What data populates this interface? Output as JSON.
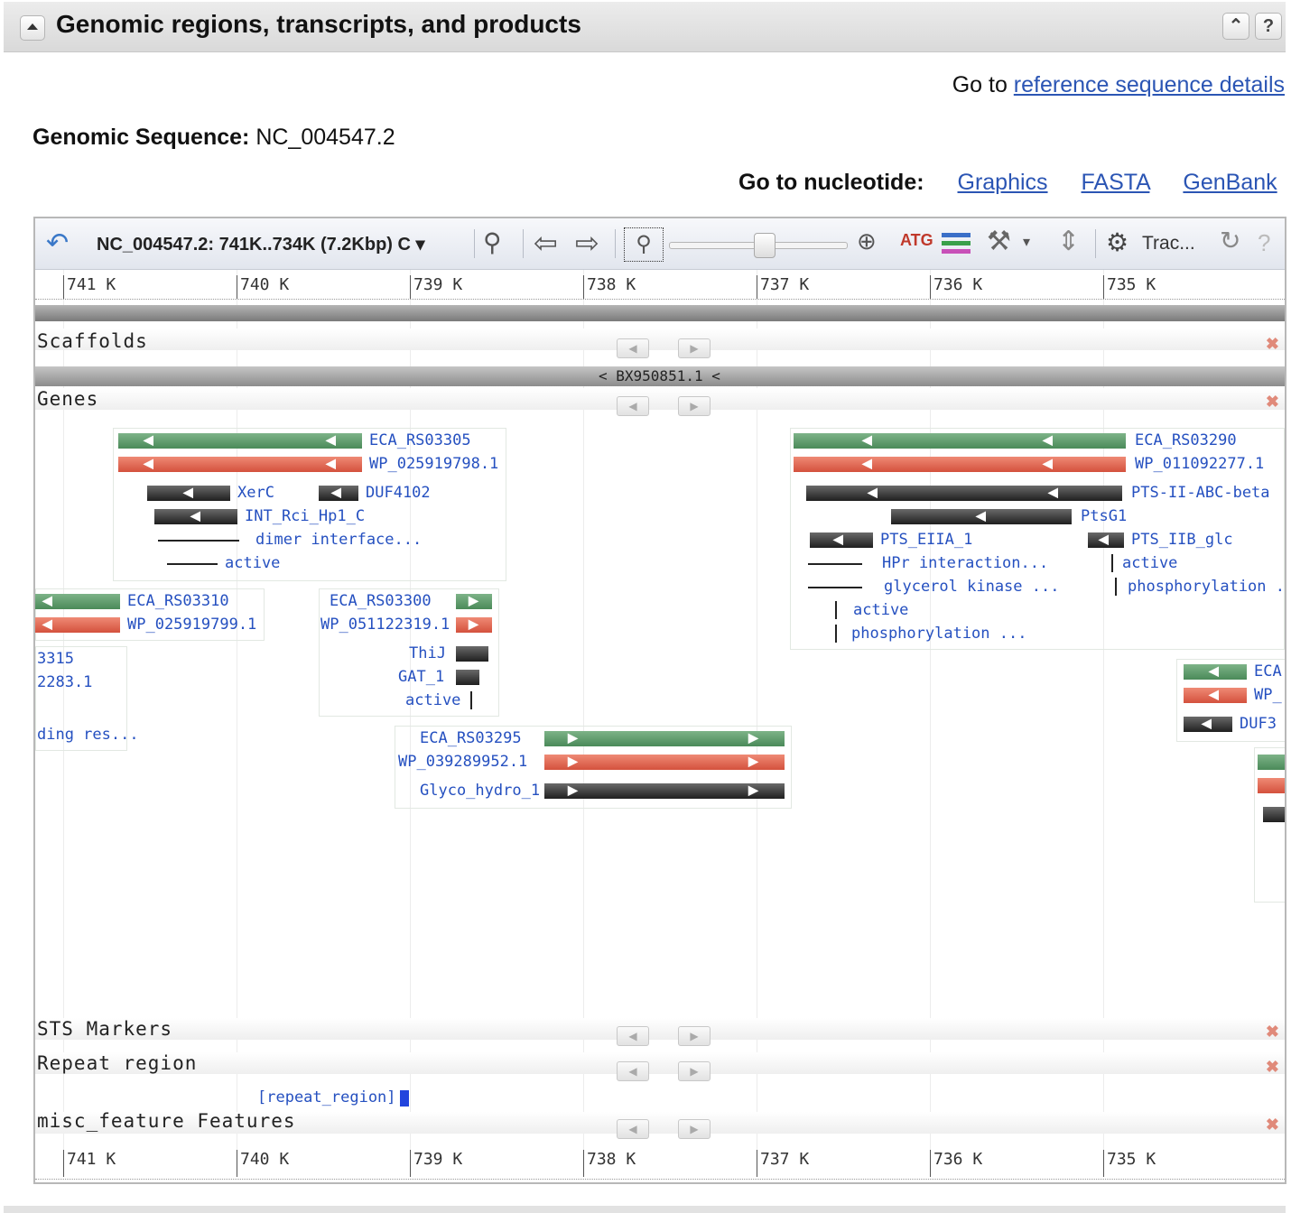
{
  "section": {
    "title": "Genomic regions, transcripts, and products"
  },
  "goto": {
    "prefix": "Go to ",
    "link": "reference sequence details"
  },
  "genomic": {
    "label": "Genomic Sequence:",
    "value": "NC_004547.2"
  },
  "nucleotide": {
    "label": "Go to nucleotide:",
    "links": [
      "Graphics",
      "FASTA",
      "GenBank"
    ]
  },
  "toolbar": {
    "region": "NC_004547.2: 741K..734K (7.2Kbp) C",
    "tracks": "Trac..."
  },
  "ruler": {
    "ticks": [
      "741 K",
      "740 K",
      "739 K",
      "738 K",
      "737 K",
      "736 K",
      "735 K"
    ]
  },
  "tracks": {
    "scaffolds": "Scaffolds",
    "scaffold_name": "BX950851.1",
    "genes": "Genes",
    "sts": "STS Markers",
    "repeat": "Repeat region",
    "repeat_feature": "[repeat_region]",
    "misc": "misc_feature Features"
  },
  "genes": {
    "g1": {
      "gene": "ECA_RS03305",
      "protein": "WP_025919798.1",
      "d1": "XerC",
      "d2": "DUF4102",
      "d3": "INT_Rci_Hp1_C",
      "d4": "dimer interface...",
      "d5": "active"
    },
    "g2": {
      "gene": "ECA_RS03290",
      "protein": "WP_011092277.1",
      "d1": "PTS-II-ABC-beta",
      "d2": "PtsG1",
      "d3": "PTS_EIIA_1",
      "d4": "PTS_IIB_glc",
      "d5": "HPr interaction...",
      "d6": "active",
      "d7": "glycerol kinase ...",
      "d8": "phosphorylation ...",
      "d9": "active",
      "d10": "phosphorylation ..."
    },
    "g3": {
      "gene": "ECA_RS03310",
      "protein": "WP_025919799.1"
    },
    "g4": {
      "gene": "ECA_RS03300",
      "protein": "WP_051122319.1",
      "d1": "ThiJ",
      "d2": "GAT_1",
      "d3": "active"
    },
    "g5": {
      "gene": "3315",
      "protein": "2283.1",
      "d1": "ding res..."
    },
    "g6": {
      "gene": "ECA_RS03295",
      "protein": "WP_039289952.1",
      "d1": "Glyco_hydro_1"
    },
    "g7": {
      "gene": "ECA",
      "protein": "WP_",
      "d1": "DUF3"
    }
  },
  "colors": {
    "gene": "#4a8a59",
    "protein": "#d4513d",
    "domain": "#1f1f1f",
    "link": "#2b55b4",
    "label": "#2550c0"
  }
}
